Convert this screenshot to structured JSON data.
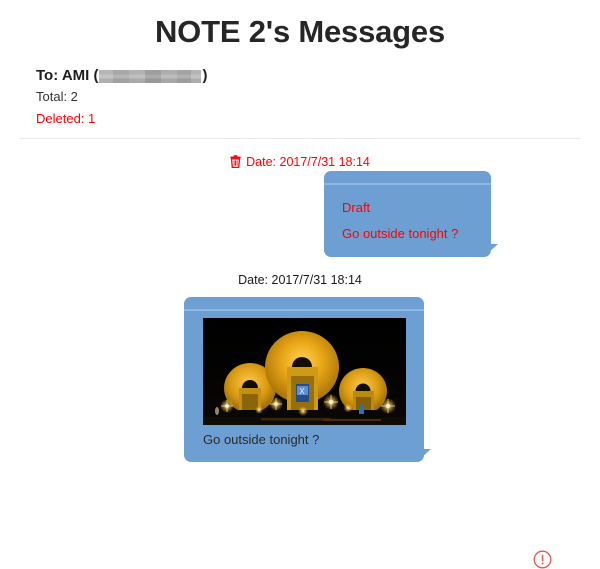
{
  "page": {
    "title": "NOTE 2's Messages"
  },
  "header": {
    "to_label": "To: AMI (",
    "to_close": ")",
    "redacted_value": "",
    "total_label": "Total: 2",
    "deleted_label": "Deleted: 1"
  },
  "colors": {
    "bubble": "#6d9fd2",
    "bubble_topbar_line": "#8fb8df",
    "deleted_red": "#ff0000",
    "title": "#262626",
    "divider": "#e8e8e8",
    "error": "#e8564f"
  },
  "messages": [
    {
      "deleted": true,
      "trash_icon": "trash-icon",
      "date_label": "Date: 2017/7/31 18:14",
      "status_label": "Draft",
      "text": "Go outside tonight ?",
      "has_image": false,
      "has_error": false
    },
    {
      "deleted": false,
      "date_label": "Date: 2017/7/31 18:14",
      "status_label": "",
      "text": "Go outside tonight ?",
      "has_image": true,
      "image_alt": "night photo of illuminated golden satellite dishes",
      "has_error": true,
      "error_icon": "exclamation-circle-icon"
    }
  ]
}
